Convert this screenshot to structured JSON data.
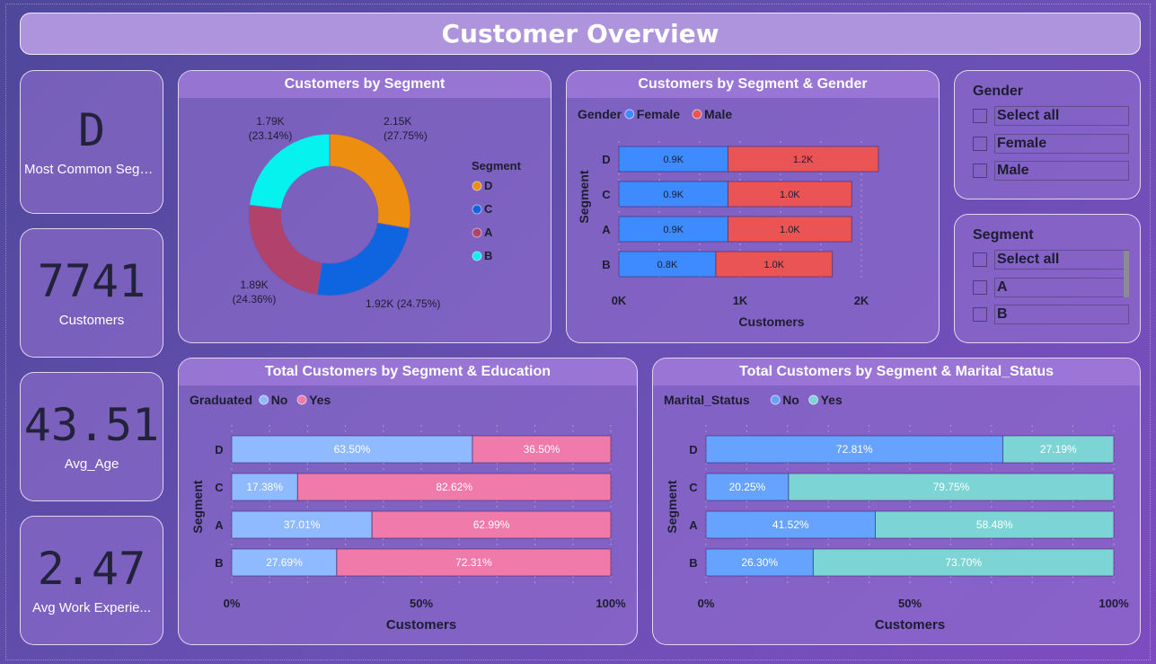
{
  "title": "Customer Overview",
  "kpis": [
    {
      "value": "D",
      "label": "Most Common Segm..."
    },
    {
      "value": "7741",
      "label": "Customers"
    },
    {
      "value": "43.51",
      "label": "Avg_Age"
    },
    {
      "value": "2.47",
      "label": "Avg Work Experie..."
    }
  ],
  "colors": {
    "female": "#3d8bff",
    "male": "#ea5455",
    "grad_no": "#8fbaff",
    "grad_yes": "#f07aaa",
    "mar_no": "#65a3ff",
    "mar_yes": "#7dd4d4",
    "seg_D": "#ee8e10",
    "seg_C": "#0f64e0",
    "seg_A": "#b0426c",
    "seg_B": "#06f2ef"
  },
  "donut": {
    "title": "Customers by Segment",
    "legend_title": "Segment",
    "chart_data": {
      "type": "pie",
      "categories": [
        "D",
        "C",
        "A",
        "B"
      ],
      "values": [
        2150,
        1920,
        1890,
        1790
      ],
      "labels": [
        "2.15K\n(27.75%)",
        "1.92K (24.75%)",
        "1.89K\n(24.36%)",
        "1.79K\n(23.14%)"
      ]
    }
  },
  "gender_chart": {
    "title": "Customers by Segment & Gender",
    "legend_title": "Gender",
    "chart_data": {
      "type": "bar",
      "categories": [
        "D",
        "C",
        "A",
        "B"
      ],
      "series": [
        {
          "name": "Female",
          "values": [
            0.9,
            0.9,
            0.9,
            0.8
          ],
          "labels": [
            "0.9K",
            "0.9K",
            "0.9K",
            "0.8K"
          ]
        },
        {
          "name": "Male",
          "values": [
            1.24,
            1.02,
            1.02,
            0.96
          ],
          "labels": [
            "1.2K",
            "1.0K",
            "1.0K",
            "1.0K"
          ]
        }
      ],
      "xticks": [
        "0K",
        "1K",
        "2K"
      ],
      "xlim": [
        0,
        2
      ],
      "xlabel": "Customers",
      "ylabel": "Segment"
    }
  },
  "education_chart": {
    "title": "Total Customers by Segment & Education",
    "legend_title": "Graduated",
    "chart_data": {
      "type": "bar",
      "categories": [
        "D",
        "C",
        "A",
        "B"
      ],
      "series": [
        {
          "name": "No",
          "values": [
            63.5,
            17.38,
            37.01,
            27.69
          ],
          "labels": [
            "63.50%",
            "17.38%",
            "37.01%",
            "27.69%"
          ]
        },
        {
          "name": "Yes",
          "values": [
            36.5,
            82.62,
            62.99,
            72.31
          ],
          "labels": [
            "36.50%",
            "82.62%",
            "62.99%",
            "72.31%"
          ]
        }
      ],
      "xticks": [
        "0%",
        "50%",
        "100%"
      ],
      "xlabel": "Customers",
      "ylabel": "Segment"
    }
  },
  "marital_chart": {
    "title": "Total Customers by Segment & Marital_Status",
    "legend_title": "Marital_Status",
    "chart_data": {
      "type": "bar",
      "categories": [
        "D",
        "C",
        "A",
        "B"
      ],
      "series": [
        {
          "name": "No",
          "values": [
            72.81,
            20.25,
            41.52,
            26.3
          ],
          "labels": [
            "72.81%",
            "20.25%",
            "41.52%",
            "26.30%"
          ]
        },
        {
          "name": "Yes",
          "values": [
            27.19,
            79.75,
            58.48,
            73.7
          ],
          "labels": [
            "27.19%",
            "79.75%",
            "58.48%",
            "73.70%"
          ]
        }
      ],
      "xticks": [
        "0%",
        "50%",
        "100%"
      ],
      "xlabel": "Customers",
      "ylabel": "Segment"
    }
  },
  "gender_slicer": {
    "title": "Gender",
    "items": [
      "Select all",
      "Female",
      "Male"
    ]
  },
  "segment_slicer": {
    "title": "Segment",
    "items": [
      "Select all",
      "A",
      "B"
    ]
  }
}
